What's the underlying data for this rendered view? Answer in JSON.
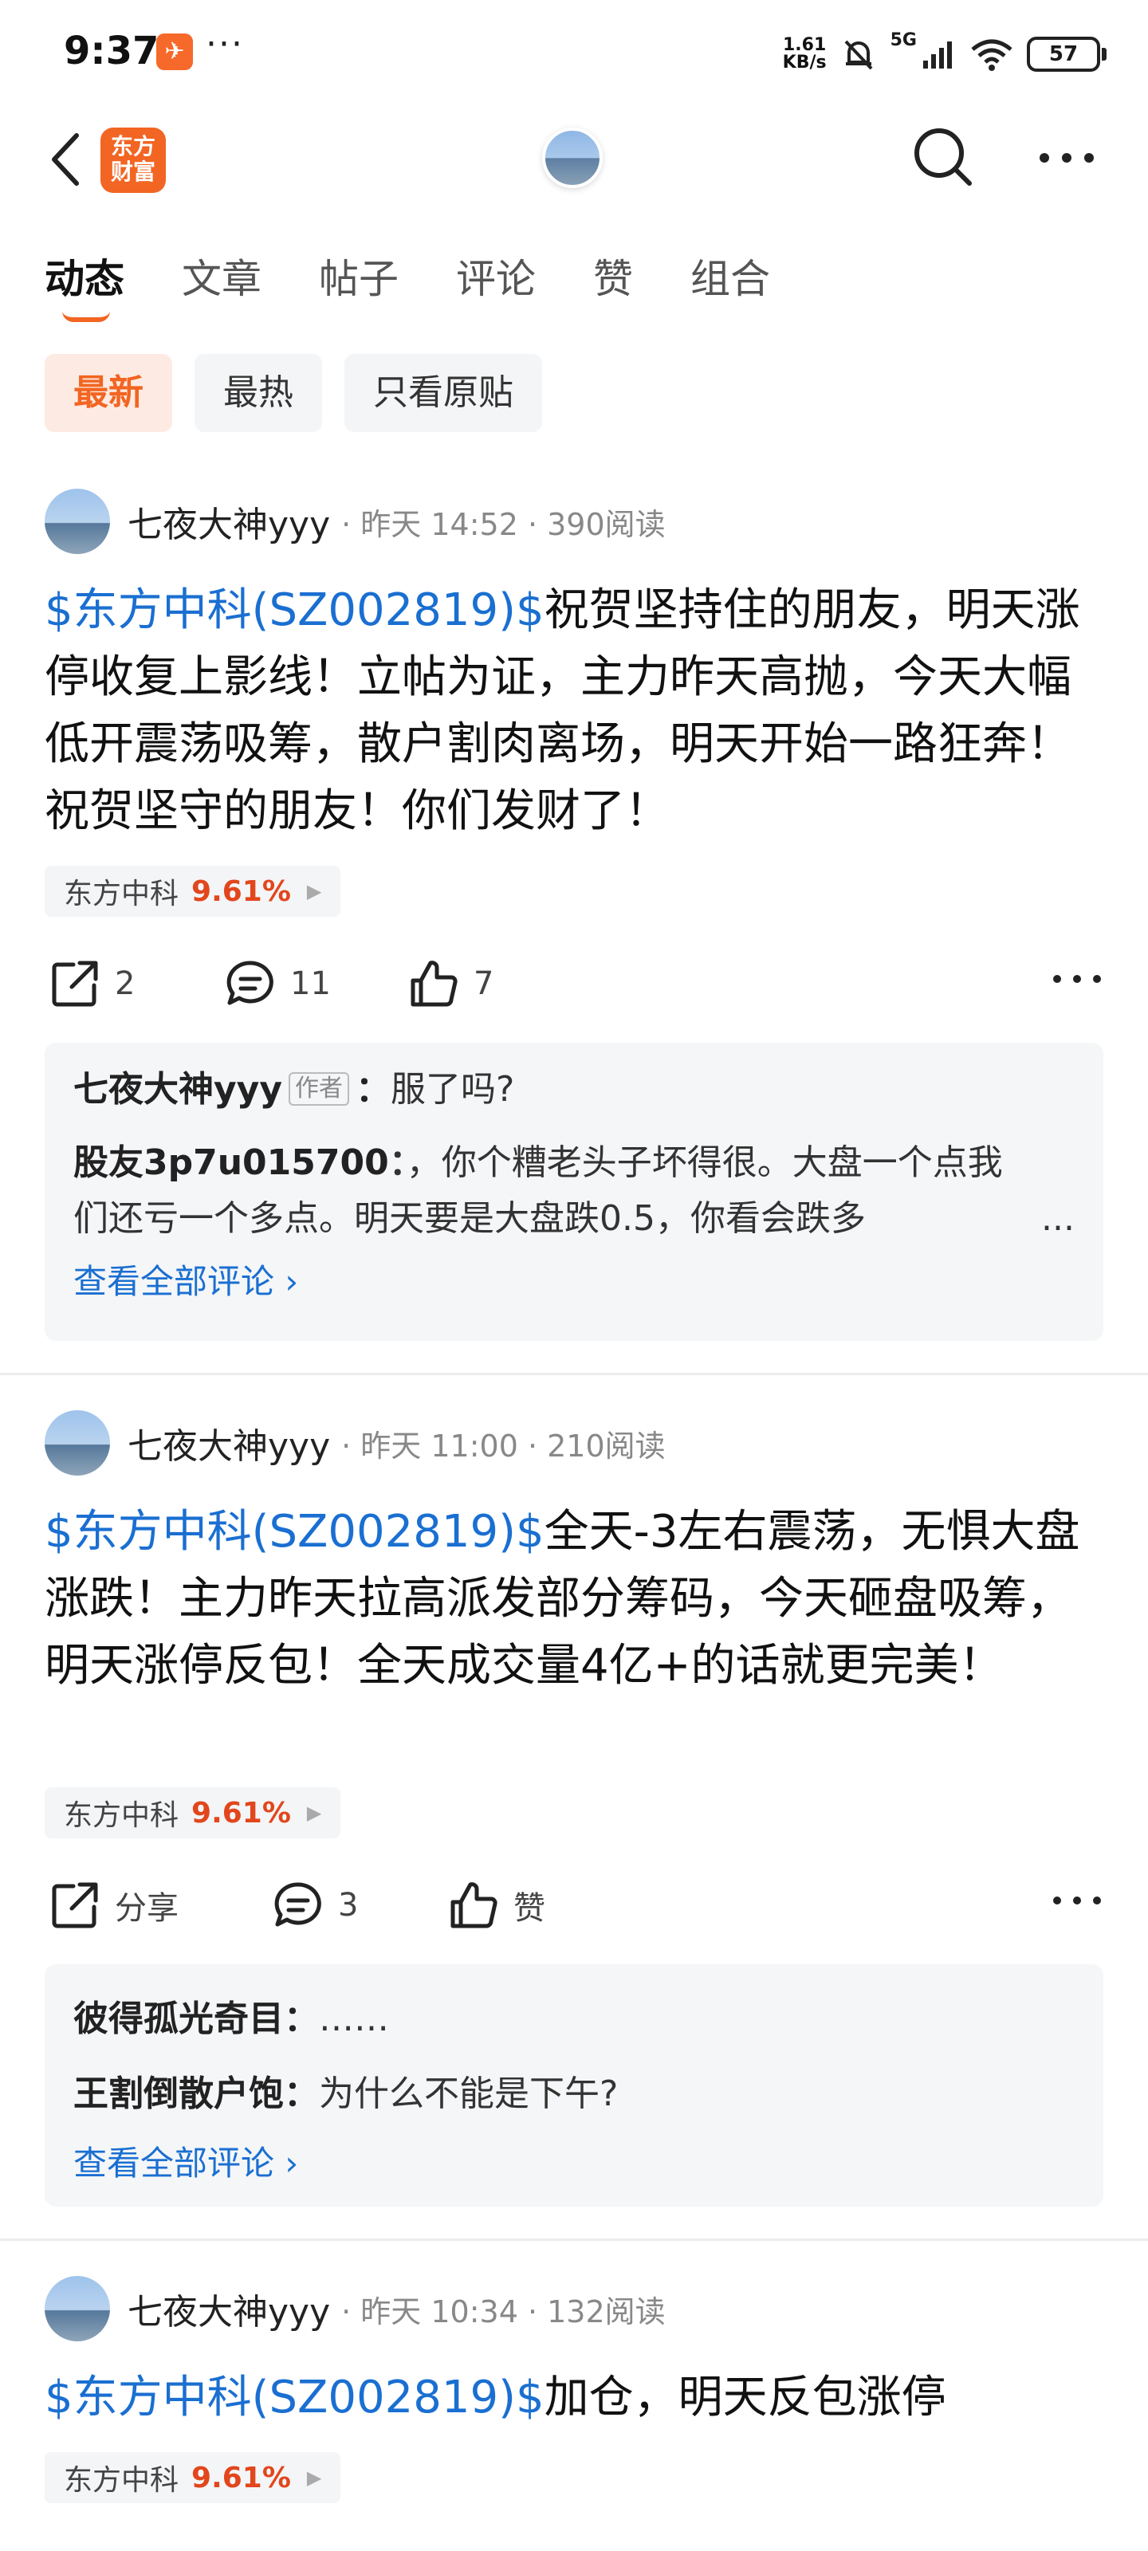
{
  "status": {
    "time": "9:37",
    "app_badge": "✈",
    "more": "···",
    "speed_top": "1.61",
    "speed_bottom": "KB/s",
    "net": "5G",
    "battery": "57"
  },
  "header": {
    "logo_line1": "东方",
    "logo_line2": "财富"
  },
  "tabs": [
    "动态",
    "文章",
    "帖子",
    "评论",
    "赞",
    "组合"
  ],
  "chips": [
    "最新",
    "最热",
    "只看原贴"
  ],
  "posts": [
    {
      "user": "七夜大神yyy",
      "meta": "· 昨天 14:52 · 390阅读",
      "stock_link": "$东方中科(SZ002819)$",
      "text": "祝贺坚持住的朋友，明天涨停收复上影线！立帖为证，主力昨天高抛，今天大幅低开震荡吸筹，散户割肉离场，明天开始一路狂奔！祝贺坚守的朋友！你们发财了！",
      "tag_name": "东方中科",
      "tag_pct": "9.61%",
      "share": "2",
      "comment": "11",
      "like": "7",
      "comments": {
        "c1_user": "七夜大神yyy",
        "c1_tag": "作者",
        "c1_sep": "：",
        "c1_text": "服了吗?",
        "c2_user": "股友3p7u015700",
        "c2_sep": "：",
        "c2_text": "，你个糟老头子坏得很。大盘一个点我们还亏一个多点。明天要是大盘跌0.5，你看会跌多",
        "c2_ell": "...",
        "all": "查看全部评论 ›"
      }
    },
    {
      "user": "七夜大神yyy",
      "meta": "· 昨天 11:00 · 210阅读",
      "stock_link": "$东方中科(SZ002819)$",
      "text": "全天-3左右震荡，无惧大盘涨跌！主力昨天拉高派发部分筹码，今天砸盘吸筹，明天涨停反包！全天成交量4亿+的话就更完美！",
      "tag_name": "东方中科",
      "tag_pct": "9.61%",
      "share": "分享",
      "comment": "3",
      "like": "赞",
      "comments": {
        "c1_user": "彼得孤光奇目",
        "c1_sep": "：",
        "c1_text": "……",
        "c2_user": "王割倒散户饱",
        "c2_sep": "：",
        "c2_text": "为什么不能是下午?",
        "all": "查看全部评论 ›"
      }
    },
    {
      "user": "七夜大神yyy",
      "meta": "· 昨天 10:34 · 132阅读",
      "stock_link": "$东方中科(SZ002819)$",
      "text": "加仓，明天反包涨停",
      "tag_name": "东方中科",
      "tag_pct": "9.61%"
    }
  ]
}
